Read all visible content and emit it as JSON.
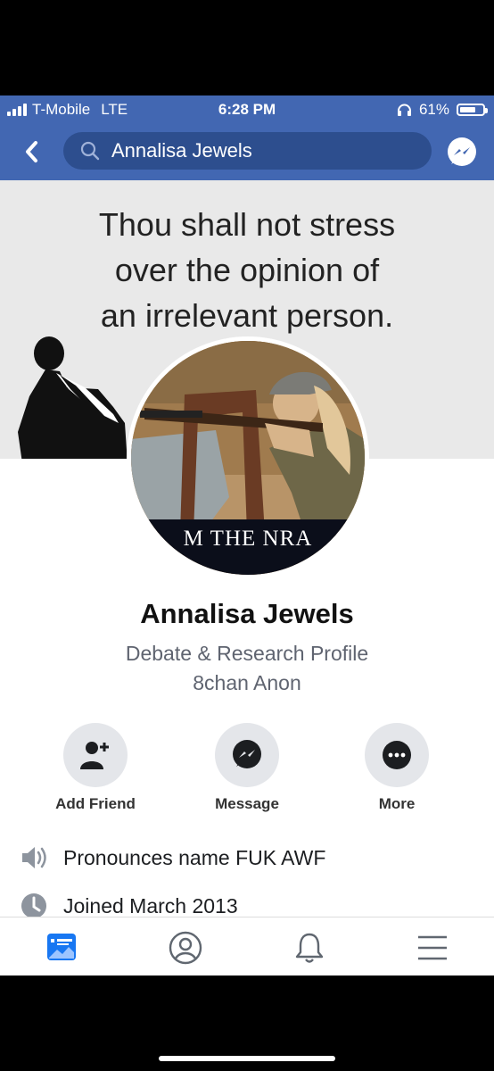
{
  "status_bar": {
    "carrier": "T-Mobile",
    "network": "LTE",
    "time": "6:28 PM",
    "battery": "61%"
  },
  "nav": {
    "search_value": "Annalisa Jewels",
    "icons": [
      "back-chevron-icon",
      "search-icon",
      "messenger-icon"
    ]
  },
  "cover": {
    "quote_lines": [
      "Thou shall not stress",
      "over the opinion of",
      "an irrelevant person."
    ]
  },
  "avatar": {
    "banner_text": "M THE NRA"
  },
  "profile": {
    "name": "Annalisa Jewels",
    "bio_line1": "Debate & Research Profile",
    "bio_line2": "8chan Anon"
  },
  "actions": {
    "add_friend": "Add Friend",
    "message": "Message",
    "more": "More"
  },
  "intro": {
    "pronounce": "Pronounces name FUK AWF",
    "joined": "Joined March 2013"
  },
  "tab_bar": {
    "icons": [
      "news-feed-icon",
      "profile-icon",
      "notifications-icon",
      "menu-icon"
    ],
    "active": "news-feed-icon"
  },
  "colors": {
    "brand": "#4267b2",
    "search_bg": "#2d4e8e",
    "active_tab": "#1877f2"
  }
}
